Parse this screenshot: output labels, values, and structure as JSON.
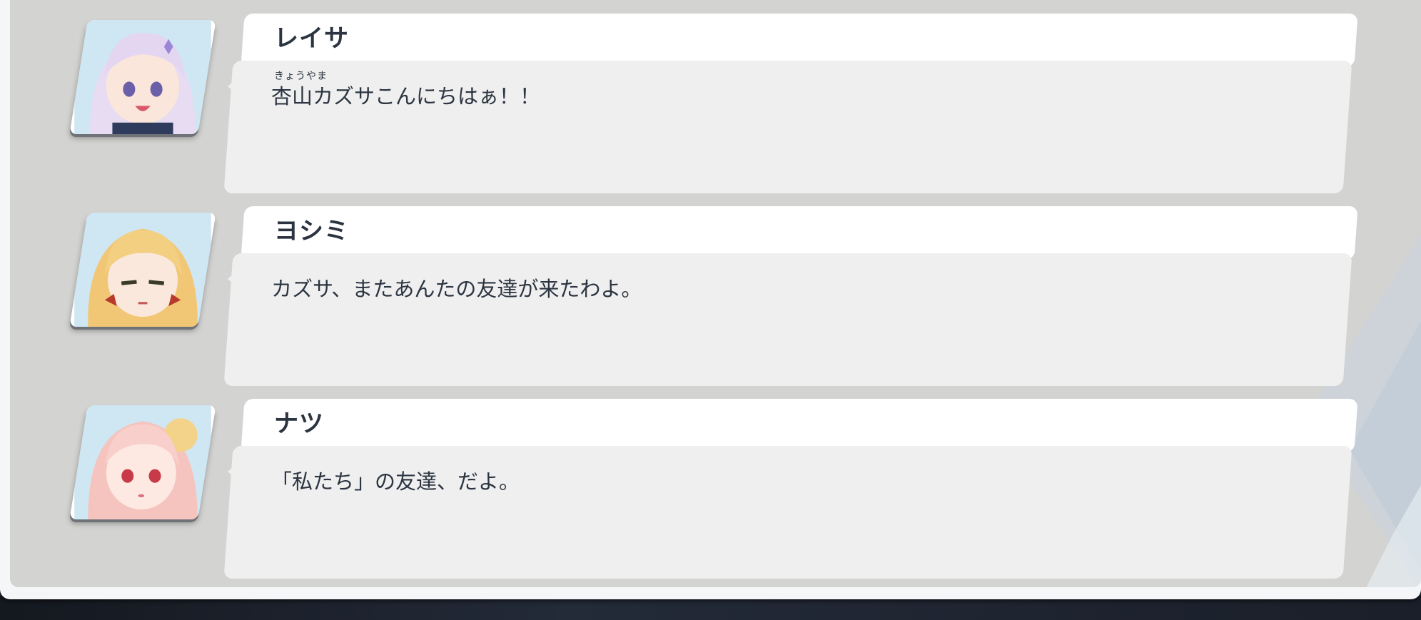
{
  "dialogue_log": [
    {
      "speaker": "レイサ",
      "portrait_icon": "reisa-portrait",
      "ruby": "きょうやま",
      "ruby_base": "杏山",
      "text_rest": "カズサこんにちはぁ！！"
    },
    {
      "speaker": "ヨシミ",
      "portrait_icon": "yoshimi-portrait",
      "text": "カズサ、またあんたの友達が来たわよ。"
    },
    {
      "speaker": "ナツ",
      "portrait_icon": "natsu-portrait",
      "text": "「私たち」の友達、だよ。"
    }
  ],
  "colors": {
    "panel_bg": "#d3d3d1",
    "name_plate": "#ffffff",
    "message_box": "#efefef",
    "text": "#2b3440"
  }
}
